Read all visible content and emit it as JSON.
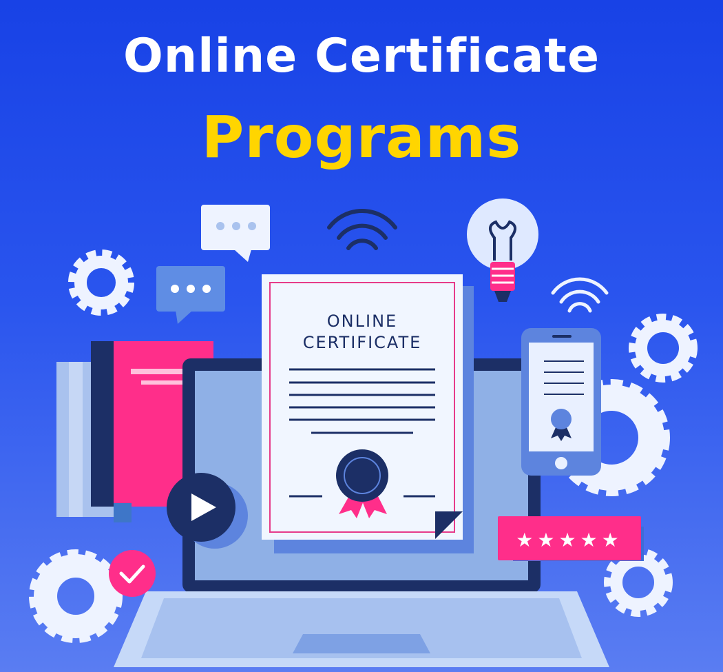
{
  "headline": {
    "line1": "Online Certificate",
    "line2": "Programs"
  },
  "certificate": {
    "line1": "ONLINE",
    "line2": "CERTIFICATE"
  },
  "rating": {
    "stars": 5,
    "glyph": "★★★★★"
  },
  "colors": {
    "background_top": "#1842e6",
    "headline_white": "#ffffff",
    "headline_yellow": "#ffd500",
    "accent_pink": "#ff2e8a",
    "navy": "#1c2f66",
    "light_blue": "#a9c2ee",
    "paper": "#f1f6ff"
  },
  "icons": [
    "gear-icon",
    "chat-bubble-icon",
    "wifi-icon",
    "light-bulb-icon",
    "play-icon",
    "check-icon",
    "star-icon",
    "award-ribbon-icon",
    "smartphone-icon",
    "laptop-icon",
    "book-icon"
  ]
}
